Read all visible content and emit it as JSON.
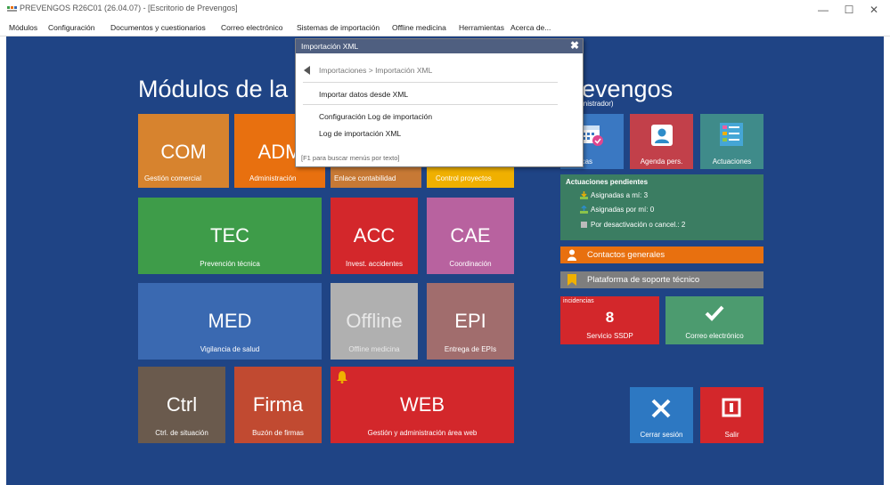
{
  "window": {
    "title": "PREVENGOS R26C01 (26.04.07) - [Escritorio de Prevengos]",
    "min": "—",
    "max": "☐",
    "close": "✕"
  },
  "menu": [
    "Módulos",
    "Configuración",
    "Documentos y cuestionarios",
    "Correo electrónico",
    "Sistemas de importación",
    "Offline medicina",
    "Herramientas",
    "Acerca de..."
  ],
  "heading_left": "Módulos de la",
  "heading_right": "evengos",
  "heading_sub": "inistrador)",
  "tiles": {
    "com": {
      "big": "COM",
      "small": "Gestión comercial"
    },
    "adm": {
      "big": "ADM",
      "small": "Administración"
    },
    "enlace": {
      "small": "Enlace contabilidad"
    },
    "control": {
      "small": "Control proyectos"
    },
    "tec": {
      "big": "TEC",
      "small": "Prevención técnica"
    },
    "acc": {
      "big": "ACC",
      "small": "Invest. accidentes"
    },
    "cae": {
      "big": "CAE",
      "small": "Coordinación"
    },
    "med": {
      "big": "MED",
      "small": "Vigilancia de salud"
    },
    "offline": {
      "big": "Offline",
      "small": "Offline medicina"
    },
    "epi": {
      "big": "EPI",
      "small": "Entrega de EPIs"
    },
    "ctrl": {
      "big": "Ctrl",
      "small": "Ctrl. de situación"
    },
    "firma": {
      "big": "Firma",
      "small": "Buzón de firmas"
    },
    "web": {
      "big": "WEB",
      "small": "Gestión y administración área web"
    }
  },
  "right_tiles": {
    "citas": "s medicas",
    "agenda": "Agenda pers.",
    "actuaciones": "Actuaciones"
  },
  "pending": {
    "title": "Actuaciones pendientes",
    "rows": [
      "Asignadas a mí: 3",
      "Asignadas por mí: 0",
      "Por desactivación o cancel.: 2"
    ]
  },
  "bars": {
    "contactos": "Contactos generales",
    "soporte": "Plataforma de soporte técnico"
  },
  "incidencias": {
    "label": "incidencias",
    "count": "8",
    "small": "Servicio SSDP"
  },
  "correo": {
    "small": "Correo electrónico"
  },
  "cerrar": {
    "small": "Cerrar sesión"
  },
  "salir": {
    "small": "Salir"
  },
  "popup": {
    "title": "Importación XML",
    "close": "✖",
    "breadcrumb": "Importaciones > Importación XML",
    "items": [
      "Importar datos desde XML",
      "Configuración Log de importación",
      "Log de importación XML"
    ],
    "hint": "[F1 para buscar menús por texto]"
  },
  "colors": {
    "desktop": "#1f4485",
    "com": "#d7832e",
    "adm": "#e8700f",
    "enlace": "#c77935",
    "control": "#f0b000",
    "tec": "#3e9c49",
    "acc": "#d3272b",
    "cae": "#b8629f",
    "med": "#3a69b1",
    "offline": "#b0b0b0",
    "epi": "#a16d6d",
    "ctrl": "#6a5a4d",
    "firma": "#c14a31",
    "web": "#d3272b"
  }
}
